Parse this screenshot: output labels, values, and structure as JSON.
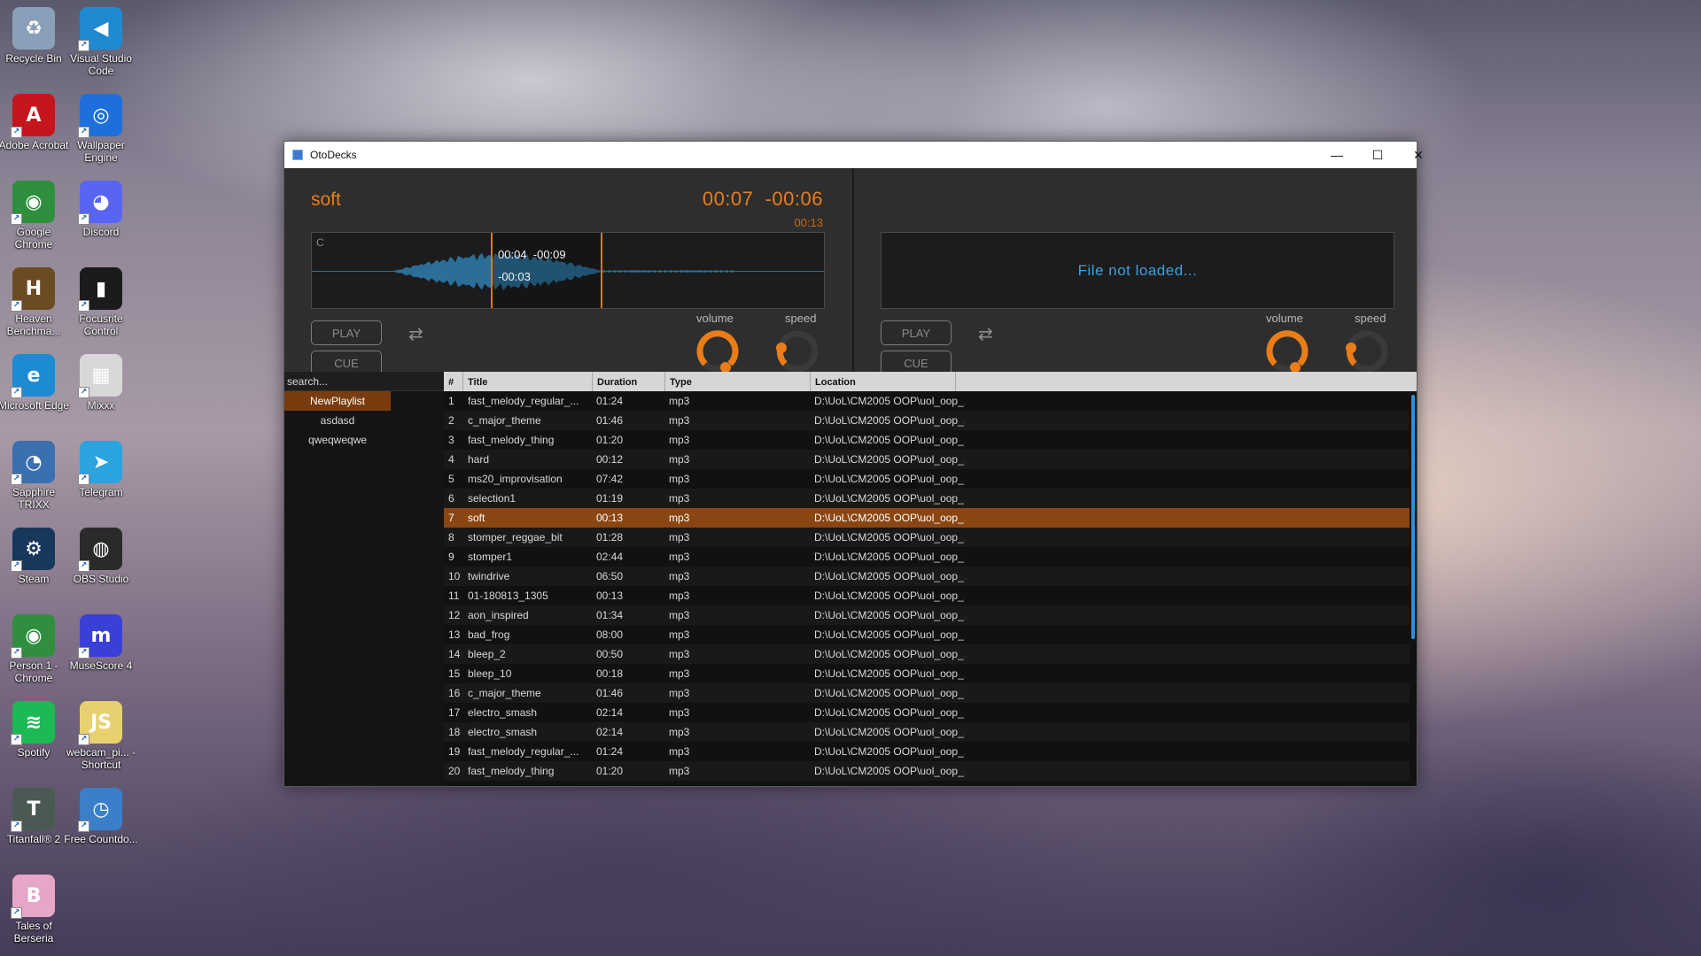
{
  "desktop": {
    "icons": [
      {
        "label": "Recycle Bin",
        "icon": "recycle-bin-icon",
        "color": "#8aa0b8",
        "glyph": "♻"
      },
      {
        "label": "Visual Studio Code",
        "icon": "vscode-icon",
        "color": "#1f8ad2",
        "glyph": "◀"
      },
      {
        "label": "Adobe Acrobat",
        "icon": "acrobat-icon",
        "color": "#c4161c",
        "glyph": "A"
      },
      {
        "label": "Wallpaper Engine",
        "icon": "wallpaper-engine-icon",
        "color": "#1e6fd9",
        "glyph": "◎"
      },
      {
        "label": "Google Chrome",
        "icon": "chrome-icon",
        "color": "#2f8f3f",
        "glyph": "◉"
      },
      {
        "label": "Discord",
        "icon": "discord-icon",
        "color": "#5865f2",
        "glyph": "◕"
      },
      {
        "label": "Heaven Benchma...",
        "icon": "heaven-benchmark-icon",
        "color": "#6b4b22",
        "glyph": "H"
      },
      {
        "label": "Focusrite Control",
        "icon": "focusrite-icon",
        "color": "#1b1b1b",
        "glyph": "▮"
      },
      {
        "label": "Microsoft Edge",
        "icon": "edge-icon",
        "color": "#1d8ad4",
        "glyph": "e"
      },
      {
        "label": "Mixxx",
        "icon": "mixxx-icon",
        "color": "#d8d8d8",
        "glyph": "▦"
      },
      {
        "label": "Sapphire TRIXX",
        "icon": "trixx-icon",
        "color": "#3a6fb0",
        "glyph": "◔"
      },
      {
        "label": "Telegram",
        "icon": "telegram-icon",
        "color": "#2aa3df",
        "glyph": "➤"
      },
      {
        "label": "Steam",
        "icon": "steam-icon",
        "color": "#17385c",
        "glyph": "⚙"
      },
      {
        "label": "OBS Studio",
        "icon": "obs-icon",
        "color": "#2a2a2a",
        "glyph": "◍"
      },
      {
        "label": "Person 1 - Chrome",
        "icon": "chrome-profile-icon",
        "color": "#2f8f3f",
        "glyph": "◉"
      },
      {
        "label": "MuseScore 4",
        "icon": "musescore-icon",
        "color": "#3a3fd6",
        "glyph": "m"
      },
      {
        "label": "Spotify",
        "icon": "spotify-icon",
        "color": "#1db954",
        "glyph": "≋"
      },
      {
        "label": "webcam_pi... - Shortcut",
        "icon": "js-file-icon",
        "color": "#e8d070",
        "glyph": "JS"
      },
      {
        "label": "Titanfall® 2",
        "icon": "titanfall-icon",
        "color": "#4a5a52",
        "glyph": "T"
      },
      {
        "label": "Free Countdo...",
        "icon": "countdown-icon",
        "color": "#3b7fc9",
        "glyph": "◷"
      },
      {
        "label": "Tales of Berseria",
        "icon": "tales-berseria-icon",
        "color": "#e6a6c8",
        "glyph": "B"
      }
    ]
  },
  "window": {
    "title": "OtoDecks",
    "controls": {
      "minimize": "—",
      "maximize": "☐",
      "close": "✕"
    }
  },
  "deck1": {
    "track": "soft",
    "time": "00:07  -00:06",
    "total": "00:13",
    "waveform_marker": "C",
    "region_times": "00:04  -00:09",
    "region_length": "-00:03",
    "play_label": "PLAY",
    "cue_label": "CUE",
    "loop_icon": "⇄",
    "volume_label": "volume",
    "speed_label": "speed"
  },
  "deck2": {
    "status": "File not loaded...",
    "play_label": "PLAY",
    "cue_label": "CUE",
    "loop_icon": "⇄",
    "volume_label": "volume",
    "speed_label": "speed"
  },
  "library": {
    "search_placeholder": "search...",
    "playlists": [
      "NewPlaylist",
      "asdasd",
      "qweqweqwe"
    ],
    "active_playlist": 0,
    "columns": [
      "#",
      "Title",
      "Duration",
      "Type",
      "Location"
    ],
    "selected_row": 6,
    "rows": [
      [
        "1",
        "fast_melody_regular_...",
        "01:24",
        "mp3",
        "D:\\UoL\\CM2005 OOP\\uol_oop_..."
      ],
      [
        "2",
        "c_major_theme",
        "01:46",
        "mp3",
        "D:\\UoL\\CM2005 OOP\\uol_oop_..."
      ],
      [
        "3",
        "fast_melody_thing",
        "01:20",
        "mp3",
        "D:\\UoL\\CM2005 OOP\\uol_oop_..."
      ],
      [
        "4",
        "hard",
        "00:12",
        "mp3",
        "D:\\UoL\\CM2005 OOP\\uol_oop_..."
      ],
      [
        "5",
        "ms20_improvisation",
        "07:42",
        "mp3",
        "D:\\UoL\\CM2005 OOP\\uol_oop_..."
      ],
      [
        "6",
        "selection1",
        "01:19",
        "mp3",
        "D:\\UoL\\CM2005 OOP\\uol_oop_..."
      ],
      [
        "7",
        "soft",
        "00:13",
        "mp3",
        "D:\\UoL\\CM2005 OOP\\uol_oop_..."
      ],
      [
        "8",
        "stomper_reggae_bit",
        "01:28",
        "mp3",
        "D:\\UoL\\CM2005 OOP\\uol_oop_..."
      ],
      [
        "9",
        "stomper1",
        "02:44",
        "mp3",
        "D:\\UoL\\CM2005 OOP\\uol_oop_..."
      ],
      [
        "10",
        "twindrive",
        "06:50",
        "mp3",
        "D:\\UoL\\CM2005 OOP\\uol_oop_..."
      ],
      [
        "11",
        "01-180813_1305",
        "00:13",
        "mp3",
        "D:\\UoL\\CM2005 OOP\\uol_oop_..."
      ],
      [
        "12",
        "aon_inspired",
        "01:34",
        "mp3",
        "D:\\UoL\\CM2005 OOP\\uol_oop_..."
      ],
      [
        "13",
        "bad_frog",
        "08:00",
        "mp3",
        "D:\\UoL\\CM2005 OOP\\uol_oop_..."
      ],
      [
        "14",
        "bleep_2",
        "00:50",
        "mp3",
        "D:\\UoL\\CM2005 OOP\\uol_oop_..."
      ],
      [
        "15",
        "bleep_10",
        "00:18",
        "mp3",
        "D:\\UoL\\CM2005 OOP\\uol_oop_..."
      ],
      [
        "16",
        "c_major_theme",
        "01:46",
        "mp3",
        "D:\\UoL\\CM2005 OOP\\uol_oop_..."
      ],
      [
        "17",
        "electro_smash",
        "02:14",
        "mp3",
        "D:\\UoL\\CM2005 OOP\\uol_oop_..."
      ],
      [
        "18",
        "electro_smash",
        "02:14",
        "mp3",
        "D:\\UoL\\CM2005 OOP\\uol_oop_..."
      ],
      [
        "19",
        "fast_melody_regular_...",
        "01:24",
        "mp3",
        "D:\\UoL\\CM2005 OOP\\uol_oop_..."
      ],
      [
        "20",
        "fast_melody_thing",
        "01:20",
        "mp3",
        "D:\\UoL\\CM2005 OOP\\uol_oop_..."
      ]
    ]
  },
  "colors": {
    "accent": "#ea7d18",
    "waveform": "#2b6f99",
    "not_loaded_text": "#3aa2e0",
    "selected_row": "#8a4612"
  }
}
